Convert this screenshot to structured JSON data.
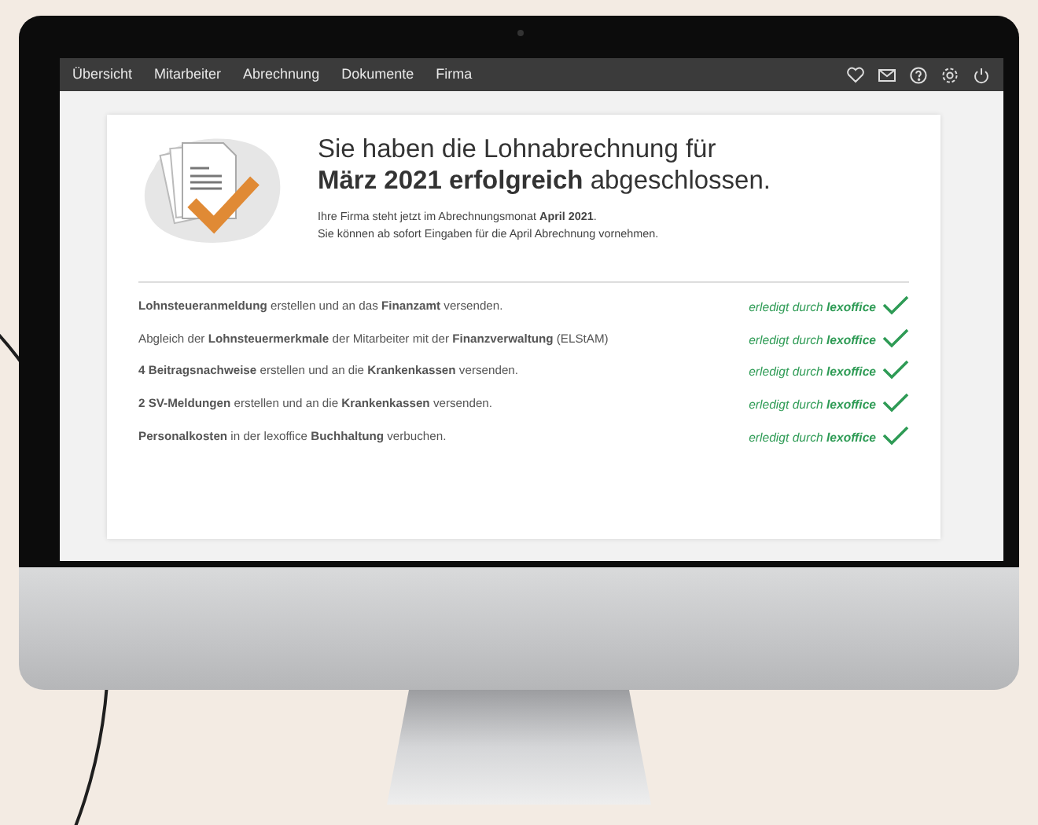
{
  "nav": {
    "items": [
      "Übersicht",
      "Mitarbeiter",
      "Abrechnung",
      "Dokumente",
      "Firma"
    ]
  },
  "headline": {
    "line1": "Sie haben die Lohnabrechnung für",
    "line2": "**März 2021 erfolgreich** abgeschlossen."
  },
  "info": [
    "Ihre Firma steht jetzt im Abrechnungsmonat **April 2021**.",
    "Sie können ab sofort Eingaben für die April Abrechnung vornehmen."
  ],
  "tasks": [
    {
      "text": "**Lohnsteueranmeldung** erstellen und an das **Finanzamt** versenden.",
      "status": "erledigt durch **lexoffice**",
      "done": true
    },
    {
      "text": "Abgleich der **Lohnsteuermerkmale** der Mitarbeiter mit der **Finanzverwaltung** (ELStAM)",
      "status": "erledigt durch **lexoffice**",
      "done": true
    },
    {
      "text": "**4 Beitragsnachweise** erstellen und an die **Krankenkassen** versenden.",
      "status": "erledigt durch **lexoffice**",
      "done": true
    },
    {
      "text": "**2 SV-Meldungen** erstellen und an die **Krankenkassen** versenden.",
      "status": "erledigt durch **lexoffice**",
      "done": true
    },
    {
      "text": "**Personalkosten** in der lexoffice **Buchhaltung** verbuchen.",
      "status": "erledigt durch **lexoffice**",
      "done": true
    }
  ]
}
